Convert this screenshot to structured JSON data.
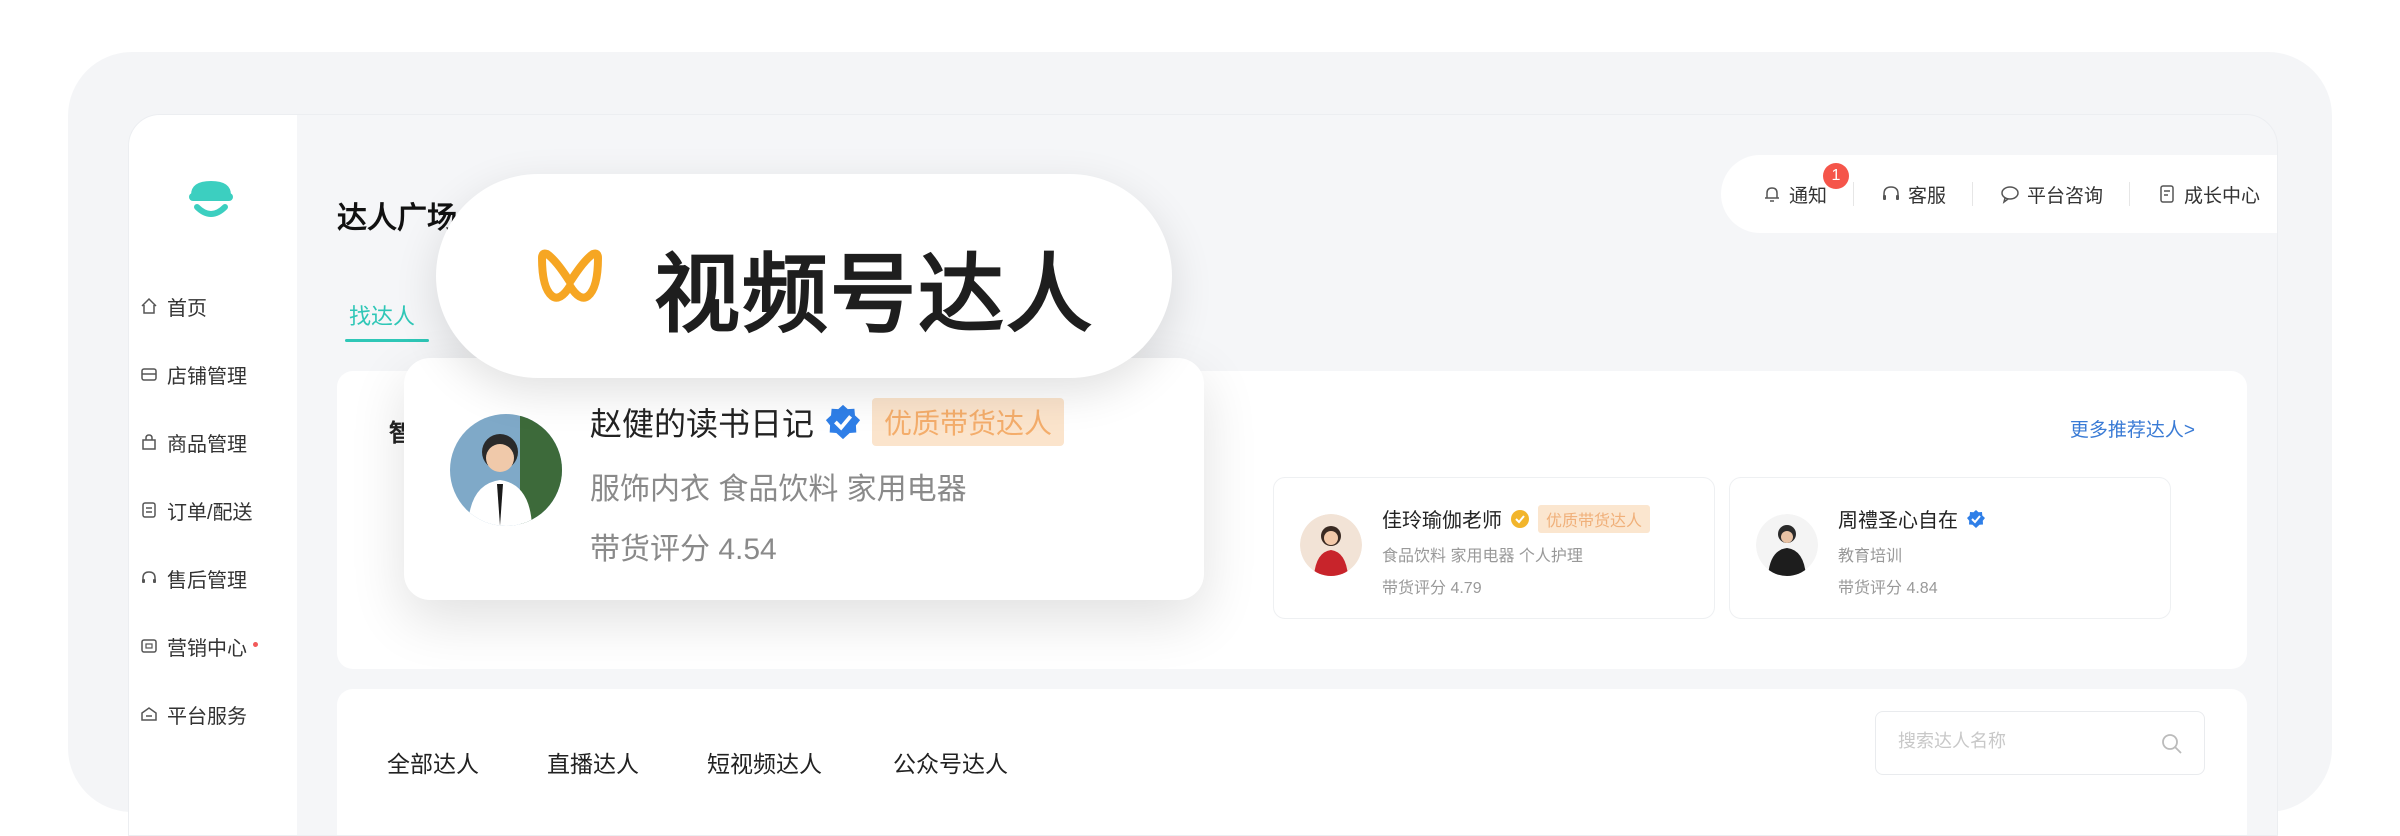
{
  "sidebar": {
    "items": [
      {
        "label": "首页",
        "icon": "home-icon"
      },
      {
        "label": "店铺管理",
        "icon": "store-icon"
      },
      {
        "label": "商品管理",
        "icon": "bag-icon"
      },
      {
        "label": "订单/配送",
        "icon": "order-icon"
      },
      {
        "label": "售后管理",
        "icon": "headset-icon"
      },
      {
        "label": "营销中心",
        "icon": "marketing-icon",
        "dot": true
      },
      {
        "label": "平台服务",
        "icon": "service-icon"
      }
    ]
  },
  "header": {
    "title": "达人广场",
    "active_tab": "找达人",
    "toolbar": {
      "notify_label": "通知",
      "notify_count": "1",
      "service_label": "客服",
      "consult_label": "平台咨询",
      "growth_label": "成长中心"
    }
  },
  "overlay": {
    "pill_text": "视频号达人",
    "featured": {
      "name": "赵健的读书日记",
      "tag": "优质带货达人",
      "categories": "服饰内衣 食品饮料 家用电器",
      "score": "带货评分 4.54"
    }
  },
  "recommend": {
    "heading": "智",
    "more_label": "更多推荐达人>",
    "cards": [
      {
        "name": "佳玲瑜伽老师",
        "verify": "gold",
        "tag": "优质带货达人",
        "categories": "食品饮料 家用电器 个人护理",
        "score": "带货评分 4.79"
      },
      {
        "name": "周禮圣心自在",
        "verify": "blue",
        "tag": "",
        "categories": "教育培训",
        "score": "带货评分 4.84"
      }
    ]
  },
  "categories": {
    "tabs": [
      "全部达人",
      "直播达人",
      "短视频达人",
      "公众号达人"
    ],
    "search_placeholder": "搜索达人名称"
  },
  "colors": {
    "accent": "#2fc7b7",
    "brand_orange": "#f6a623",
    "verify_blue": "#2f7fe8",
    "verify_gold": "#f2b52b",
    "tag_bg": "#fbe4cc",
    "tag_text": "#f4ad6b",
    "badge_red": "#f5554a",
    "link_blue": "#3a7bd5"
  }
}
